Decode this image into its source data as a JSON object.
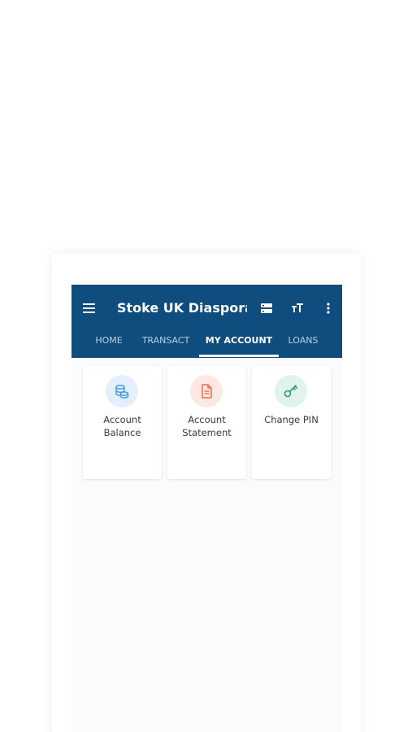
{
  "appbar": {
    "title": "Stoke UK Diaspora ...",
    "icons": [
      "menu-icon",
      "storage-icon",
      "text-size-icon",
      "more-vert-icon"
    ],
    "background_color": "#0f4d7e"
  },
  "tabs": [
    {
      "label": "HOME",
      "active": false
    },
    {
      "label": "TRANSACT",
      "active": false
    },
    {
      "label": "MY ACCOUNT",
      "active": true
    },
    {
      "label": "LOANS",
      "active": false
    }
  ],
  "cards": [
    {
      "line1": "Account",
      "line2": "Balance",
      "icon": "coins-icon",
      "icon_color": "#4a9be0",
      "icon_bg": "#e3f0fb"
    },
    {
      "line1": "Account",
      "line2": "Statement",
      "icon": "document-icon",
      "icon_color": "#f06a4f",
      "icon_bg": "#fde8e3"
    },
    {
      "line1": "Change PIN",
      "line2": "",
      "icon": "key-icon",
      "icon_color": "#2f9d7a",
      "icon_bg": "#e0f3ec"
    }
  ]
}
